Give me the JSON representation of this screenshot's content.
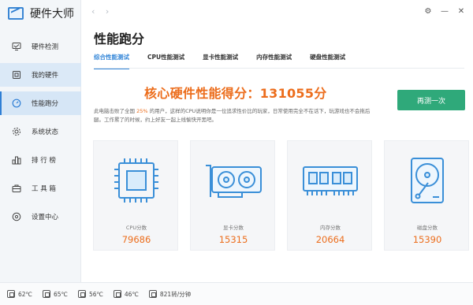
{
  "app": {
    "name": "硬件大师"
  },
  "sidebar": {
    "items": [
      {
        "label": "硬件检测",
        "icon": "monitor-check-icon"
      },
      {
        "label": "我的硬件",
        "icon": "board-icon"
      },
      {
        "label": "性能跑分",
        "icon": "gauge-icon"
      },
      {
        "label": "系统状态",
        "icon": "gear-icon"
      },
      {
        "label": "排 行 榜",
        "icon": "ranking-icon"
      },
      {
        "label": "工 具 箱",
        "icon": "toolbox-icon"
      },
      {
        "label": "设置中心",
        "icon": "settings-icon"
      }
    ]
  },
  "header": {
    "title": "性能跑分",
    "nav_back": "‹",
    "nav_forward": "›",
    "window": {
      "settings": "⚙",
      "minimize": "—",
      "close": "✕"
    }
  },
  "tabs": [
    {
      "label": "综合性能测试",
      "active": true
    },
    {
      "label": "CPU性能测试",
      "active": false
    },
    {
      "label": "显卡性能测试",
      "active": false
    },
    {
      "label": "内存性能测试",
      "active": false
    },
    {
      "label": "硬盘性能测试",
      "active": false
    }
  ],
  "score": {
    "text": "核心硬件性能得分：131055分"
  },
  "retest_label": "再测一次",
  "description": {
    "pre": "此电脑击败了全国 ",
    "percent": "25%",
    "post": " 的用户，这样的CPU说明你是一位追求性价比的玩家，日常使用完全不在话下，玩游戏也不会拖后腿。工作累了的时候，约上好友一起上线愉快开黑吧。"
  },
  "cards": [
    {
      "label": "CPU分数",
      "value": "79686",
      "icon": "cpu-icon"
    },
    {
      "label": "显卡分数",
      "value": "15315",
      "icon": "gpu-icon"
    },
    {
      "label": "内存分数",
      "value": "20664",
      "icon": "ram-icon"
    },
    {
      "label": "磁盘分数",
      "value": "15390",
      "icon": "hdd-icon"
    }
  ],
  "status": [
    {
      "value": "62℃",
      "icon": "cpu-temp-icon"
    },
    {
      "value": "65℃",
      "icon": "gpu-temp-icon"
    },
    {
      "value": "56℃",
      "icon": "board-temp-icon"
    },
    {
      "value": "46℃",
      "icon": "disk-temp-icon"
    },
    {
      "value": "821转/分钟",
      "icon": "fan-icon"
    }
  ],
  "colors": {
    "accent": "#3386d8",
    "score": "#ec6d1c",
    "button": "#2fa97a"
  }
}
